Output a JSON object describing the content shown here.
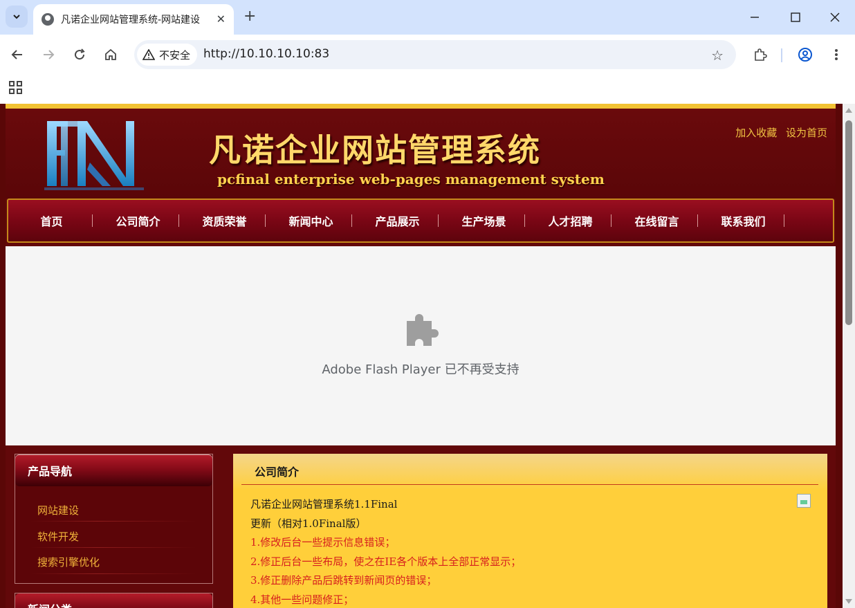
{
  "browser": {
    "tab_title": "凡诺企业网站管理系统-网站建设",
    "tab_close": "✕",
    "new_tab": "+",
    "security_label": "不安全",
    "url": "http://10.10.10.10:83"
  },
  "site": {
    "title": "凡诺企业网站管理系统",
    "subtitle": "pcfinal enterprise web-pages management system",
    "top_links": [
      "加入收藏",
      "设为首页"
    ]
  },
  "nav": {
    "items": [
      "首页",
      "公司简介",
      "资质荣誉",
      "新闻中心",
      "产品展示",
      "生产场景",
      "人才招聘",
      "在线留言",
      "联系我们"
    ]
  },
  "flash": {
    "message": "Adobe Flash Player 已不再受支持"
  },
  "sidebar": {
    "product_nav": {
      "title": "产品导航",
      "items": [
        "网站建设",
        "软件开发",
        "搜索引擎优化"
      ]
    },
    "news_category": {
      "title": "新闻分类"
    }
  },
  "content": {
    "title": "公司简介",
    "lines": [
      "凡诺企业网站管理系统1.1Final",
      "更新（相对1.0Final版）",
      "1.修改后台一些提示信息错误；",
      "2.修正后台一些布局，使之在IE各个版本上全部正常显示；",
      "3.修正删除产品后跳转到新闻页的错误；",
      "4.其他一些问题修正；"
    ]
  },
  "colors": {
    "page_bg": "#5a0707",
    "accent_gold": "#f2c233",
    "link_gold": "#f0b33a",
    "content_bg": "#ffcf3a",
    "content_red": "#d61e1e"
  }
}
